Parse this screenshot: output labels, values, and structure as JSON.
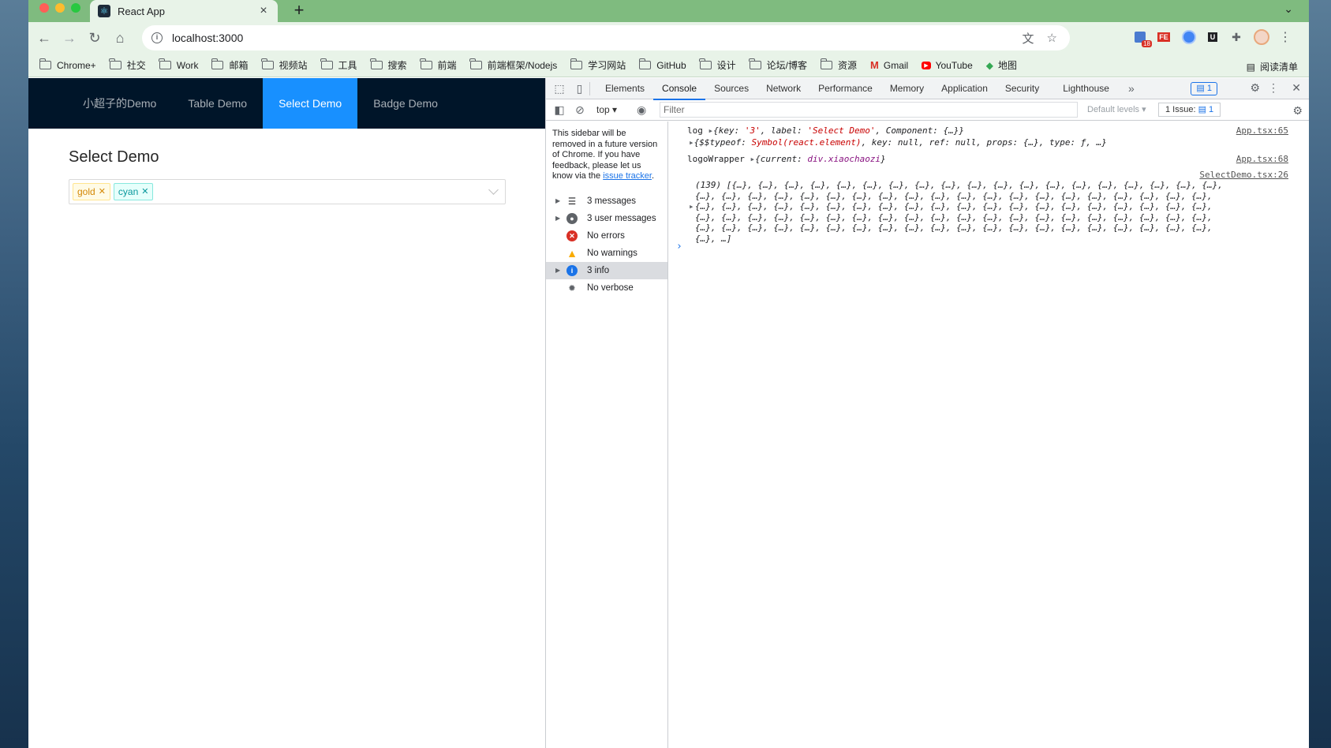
{
  "browser": {
    "tab_title": "React App",
    "url": "localhost:3000",
    "bookmarks": [
      "Chrome+",
      "社交",
      "Work",
      "邮箱",
      "视频站",
      "工具",
      "搜索",
      "前端",
      "前端框架/Nodejs",
      "学习网站",
      "GitHub",
      "设计",
      "论坛/博客",
      "资源",
      "Gmail",
      "YouTube",
      "地图"
    ],
    "reading_list": "阅读清单",
    "ext_badge": "18"
  },
  "app": {
    "nav": [
      "小超子的Demo",
      "Table Demo",
      "Select Demo",
      "Badge Demo"
    ],
    "page_title": "Select Demo",
    "tags": [
      "gold",
      "cyan"
    ]
  },
  "devtools": {
    "tabs": [
      "Elements",
      "Console",
      "Sources",
      "Network",
      "Performance",
      "Memory",
      "Application",
      "Security",
      "Lighthouse"
    ],
    "issue_count": "1",
    "context": "top",
    "filter_placeholder": "Filter",
    "levels": "Default levels",
    "issues_label": "1 Issue:",
    "issues_count": "1",
    "sidebar_note": "This sidebar will be removed in a future version of Chrome. If you have feedback, please let us know via the",
    "sidebar_link": "issue tracker",
    "sidebar_items": [
      "3 messages",
      "3 user messages",
      "No errors",
      "No warnings",
      "3 info",
      "No verbose"
    ],
    "log": {
      "line1_prefix": "log",
      "line1_obj": "{key: '3', label: 'Select Demo', Component: {…}}",
      "line1_key_open": "{key: ",
      "line1_key_val": "'3'",
      "line1_label": ", label: ",
      "line1_label_val": "'Select Demo'",
      "line1_rest": ", Component: {…}}",
      "line2_open": "{$$typeof: ",
      "line2_sym": "Symbol(react.element)",
      "line2_rest": ", key: null, ref: null, props: {…}, type: ƒ, …}",
      "src1": "App.tsx:65",
      "line3_prefix": "logoWrapper",
      "line3_open": "{current: ",
      "line3_val": "div.xiaochaozi",
      "line3_close": "}",
      "src2": "App.tsx:68",
      "src3": "SelectDemo.tsx:26",
      "arr1": "(139) [{…}, {…}, {…}, {…}, {…}, {…}, {…}, {…}, {…}, {…}, {…}, {…}, {…}, {…}, {…}, {…}, {…}, {…}, {…},",
      "arr2": "{…}, {…}, {…}, {…}, {…}, {…}, {…}, {…}, {…}, {…}, {…}, {…}, {…}, {…}, {…}, {…}, {…}, {…}, {…}, {…},",
      "arr3": "{…}, {…}, {…}, {…}, {…}, {…}, {…}, {…}, {…}, {…}, {…}, {…}, {…}, {…}, {…}, {…}, {…}, {…}, {…}, {…},",
      "arr4": "{…}, {…}, {…}, {…}, {…}, {…}, {…}, {…}, {…}, {…}, {…}, {…}, {…}, {…}, {…}, {…}, {…}, {…}, {…}, {…},",
      "arr5": "{…}, {…}, {…}, {…}, {…}, {…}, {…}, {…}, {…}, {…}, {…}, {…}, {…}, {…}, {…}, {…}, {…}, {…}, {…}, {…},",
      "arr6": "{…}, …]"
    }
  },
  "colors": {
    "accent": "#1890ff",
    "nav_bg": "#001529",
    "tab_strip": "#7fbb7f"
  }
}
